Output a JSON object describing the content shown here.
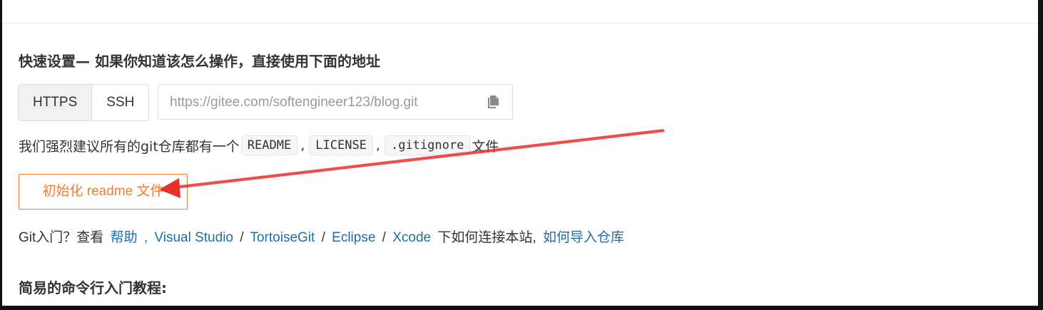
{
  "quick_setup": {
    "title": "快速设置— 如果你知道该怎么操作，直接使用下面的地址",
    "protocols": [
      {
        "label": "HTTPS",
        "active": true
      },
      {
        "label": "SSH",
        "active": false
      }
    ],
    "repo_url": "https://gitee.com/softengineer123/blog.git",
    "copy_icon": "copy-icon"
  },
  "recommend": {
    "prefix": "我们强烈建议所有的git仓库都有一个",
    "files": [
      "README",
      "LICENSE",
      ".gitignore"
    ],
    "separator": ",",
    "suffix": "文件"
  },
  "init_button": {
    "label": "初始化 readme 文件"
  },
  "help": {
    "prefix": "Git入门？查看",
    "help_link": "帮助",
    "comma": ",",
    "tools": [
      "Visual Studio",
      "TortoiseGit",
      "Eclipse",
      "Xcode"
    ],
    "slash": "/",
    "middle": "下如何连接本站,",
    "import_link": "如何导入仓库"
  },
  "tutorial": {
    "title": "简易的命令行入门教程:"
  },
  "colors": {
    "accent_orange": "#f07d36",
    "link_blue": "#1e6ea8",
    "annotation_red": "#e8302b"
  }
}
